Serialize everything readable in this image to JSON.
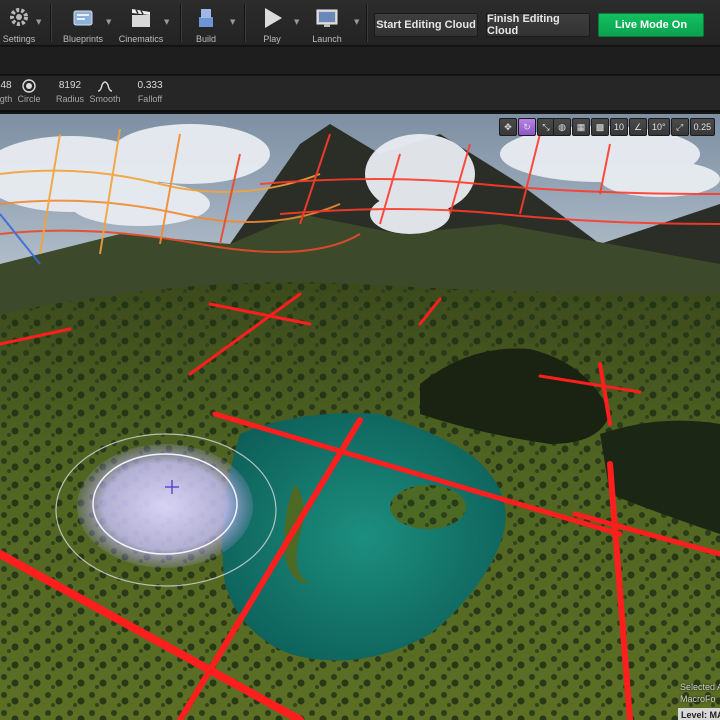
{
  "toolbar": {
    "tools": [
      {
        "id": "settings",
        "label": "Settings",
        "icon": "gear-icon"
      },
      {
        "id": "blueprints",
        "label": "Blueprints",
        "icon": "blueprint-icon"
      },
      {
        "id": "cinematics",
        "label": "Cinematics",
        "icon": "clapperboard-icon"
      },
      {
        "id": "build",
        "label": "Build",
        "icon": "build-cubes-icon"
      },
      {
        "id": "play",
        "label": "Play",
        "icon": "play-icon"
      },
      {
        "id": "launch",
        "label": "Launch",
        "icon": "launch-monitor-icon"
      }
    ],
    "start_cloud_label": "Start Editing Cloud",
    "finish_cloud_label": "Finish Editing Cloud",
    "live_mode_label": "Live Mode On",
    "live_color": "#0fb35a"
  },
  "brush": {
    "length_value": "48",
    "length_label": "gth",
    "shape_label": "Circle",
    "radius_value": "8192",
    "radius_label": "Radius",
    "smooth_label": "Smooth",
    "falloff_value": "0.333",
    "falloff_label": "Falloff"
  },
  "viewport": {
    "grid_snap_value": "10",
    "angle_snap_value": "10°",
    "scale_snap_value": "0.25",
    "brush_color": "#c9c4f2",
    "spline_color": "#ff2222",
    "selected_text": "Selected A",
    "actor_text": "MacroFo",
    "level_label": "Level: ",
    "level_value": "MAI"
  }
}
